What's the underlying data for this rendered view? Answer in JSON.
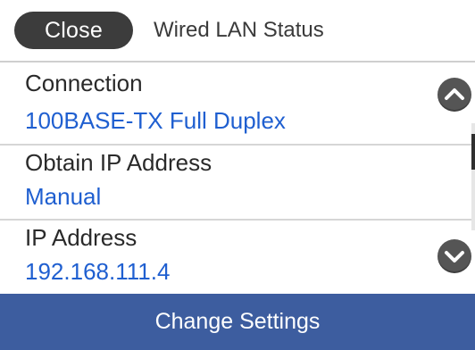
{
  "header": {
    "close_label": "Close",
    "title": "Wired LAN Status"
  },
  "rows": [
    {
      "label": "Connection",
      "value": "100BASE-TX Full Duplex"
    },
    {
      "label": "Obtain IP Address",
      "value": "Manual"
    },
    {
      "label": "IP Address",
      "value": "192.168.111.4"
    }
  ],
  "footer": {
    "button_label": "Change Settings"
  },
  "icons": {
    "scroll_up": "chevron-up-icon",
    "scroll_down": "chevron-down-icon"
  },
  "colors": {
    "close_button_bg": "#3c3c3c",
    "value_text": "#1f5fd0",
    "footer_bg": "#3d5d9f",
    "scroll_button_bg": "#555555"
  }
}
